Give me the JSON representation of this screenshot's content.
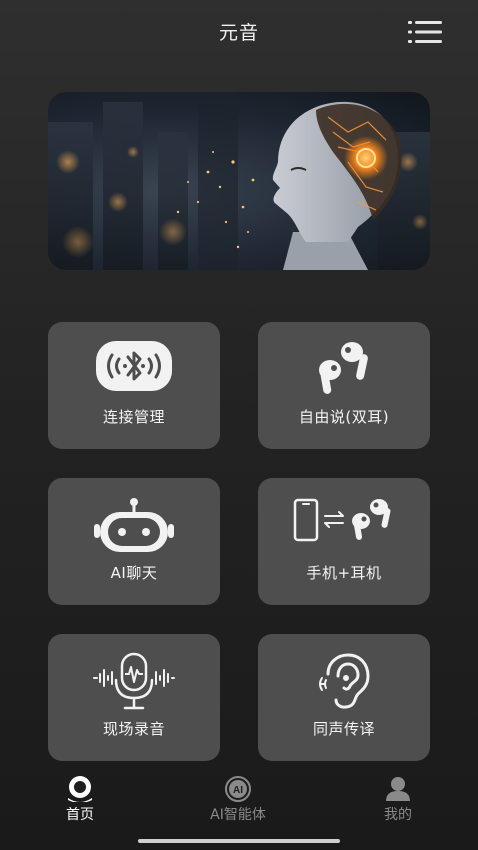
{
  "header": {
    "title": "元音"
  },
  "cards": {
    "connect": "连接管理",
    "free_talk": "自由说(双耳)",
    "ai_chat": "AI聊天",
    "phone_earphone": "手机+耳机",
    "onsite_record": "现场录音",
    "simul_interpret": "同声传译"
  },
  "tabs": {
    "home": "首页",
    "ai_agent": "AI智能体",
    "ai_badge": "AI",
    "me": "我的"
  },
  "colors": {
    "card_bg": "#4e4e4e",
    "accent_glow": "#ff8a1a",
    "tab_active": "#ffffff",
    "tab_inactive": "#8a8a8a"
  }
}
